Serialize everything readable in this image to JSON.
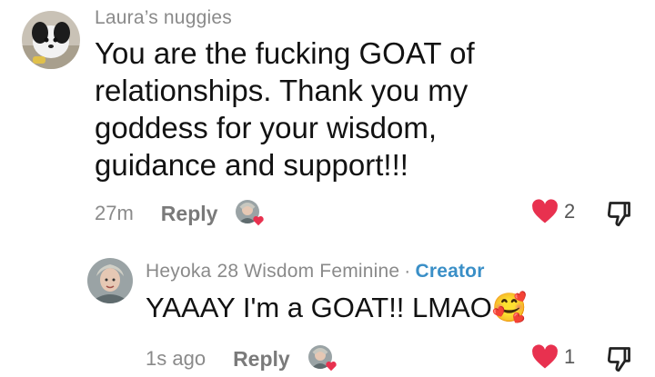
{
  "comments": [
    {
      "username": "Laura’s nuggies",
      "text_lines": [
        "You are the fucking GOAT of",
        "relationships. Thank you my",
        "goddess for your wisdom,",
        "guidance and support!!!"
      ],
      "time": "27m",
      "reply_label": "Reply",
      "like_count": "2"
    },
    {
      "username": "Heyoka 28 Wisdom Feminine",
      "separator": "·",
      "badge": "Creator",
      "text": "YAAAY I'm a GOAT!! LMAO",
      "emoji": "🥰",
      "time": "1s ago",
      "reply_label": "Reply",
      "like_count": "1"
    }
  ],
  "colors": {
    "heart": "#e8314f",
    "creator": "#3a8fc7",
    "meta": "#8a8a8a"
  }
}
